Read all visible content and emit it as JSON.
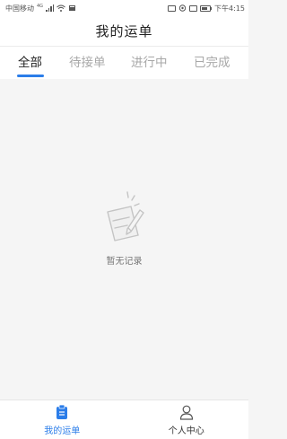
{
  "status_bar": {
    "carrier": "中国移动",
    "network": "4G",
    "time": "下午4:15",
    "icons": [
      "signal-icon",
      "wifi-icon",
      "notification-icon",
      "sim-icon",
      "vibrate-icon",
      "battery-icon"
    ]
  },
  "header": {
    "title": "我的运单"
  },
  "tabs": [
    {
      "label": "全部",
      "active": true
    },
    {
      "label": "待接单",
      "active": false
    },
    {
      "label": "进行中",
      "active": false
    },
    {
      "label": "已完成",
      "active": false
    }
  ],
  "empty_state": {
    "icon": "empty-record-icon",
    "text": "暂无记录"
  },
  "bottom_nav": [
    {
      "label": "我的运单",
      "icon": "waybill-icon",
      "active": true
    },
    {
      "label": "个人中心",
      "icon": "user-icon",
      "active": false
    }
  ],
  "colors": {
    "accent": "#2b7de9",
    "background": "#f5f5f5",
    "tab_inactive": "#a8a8a8"
  }
}
